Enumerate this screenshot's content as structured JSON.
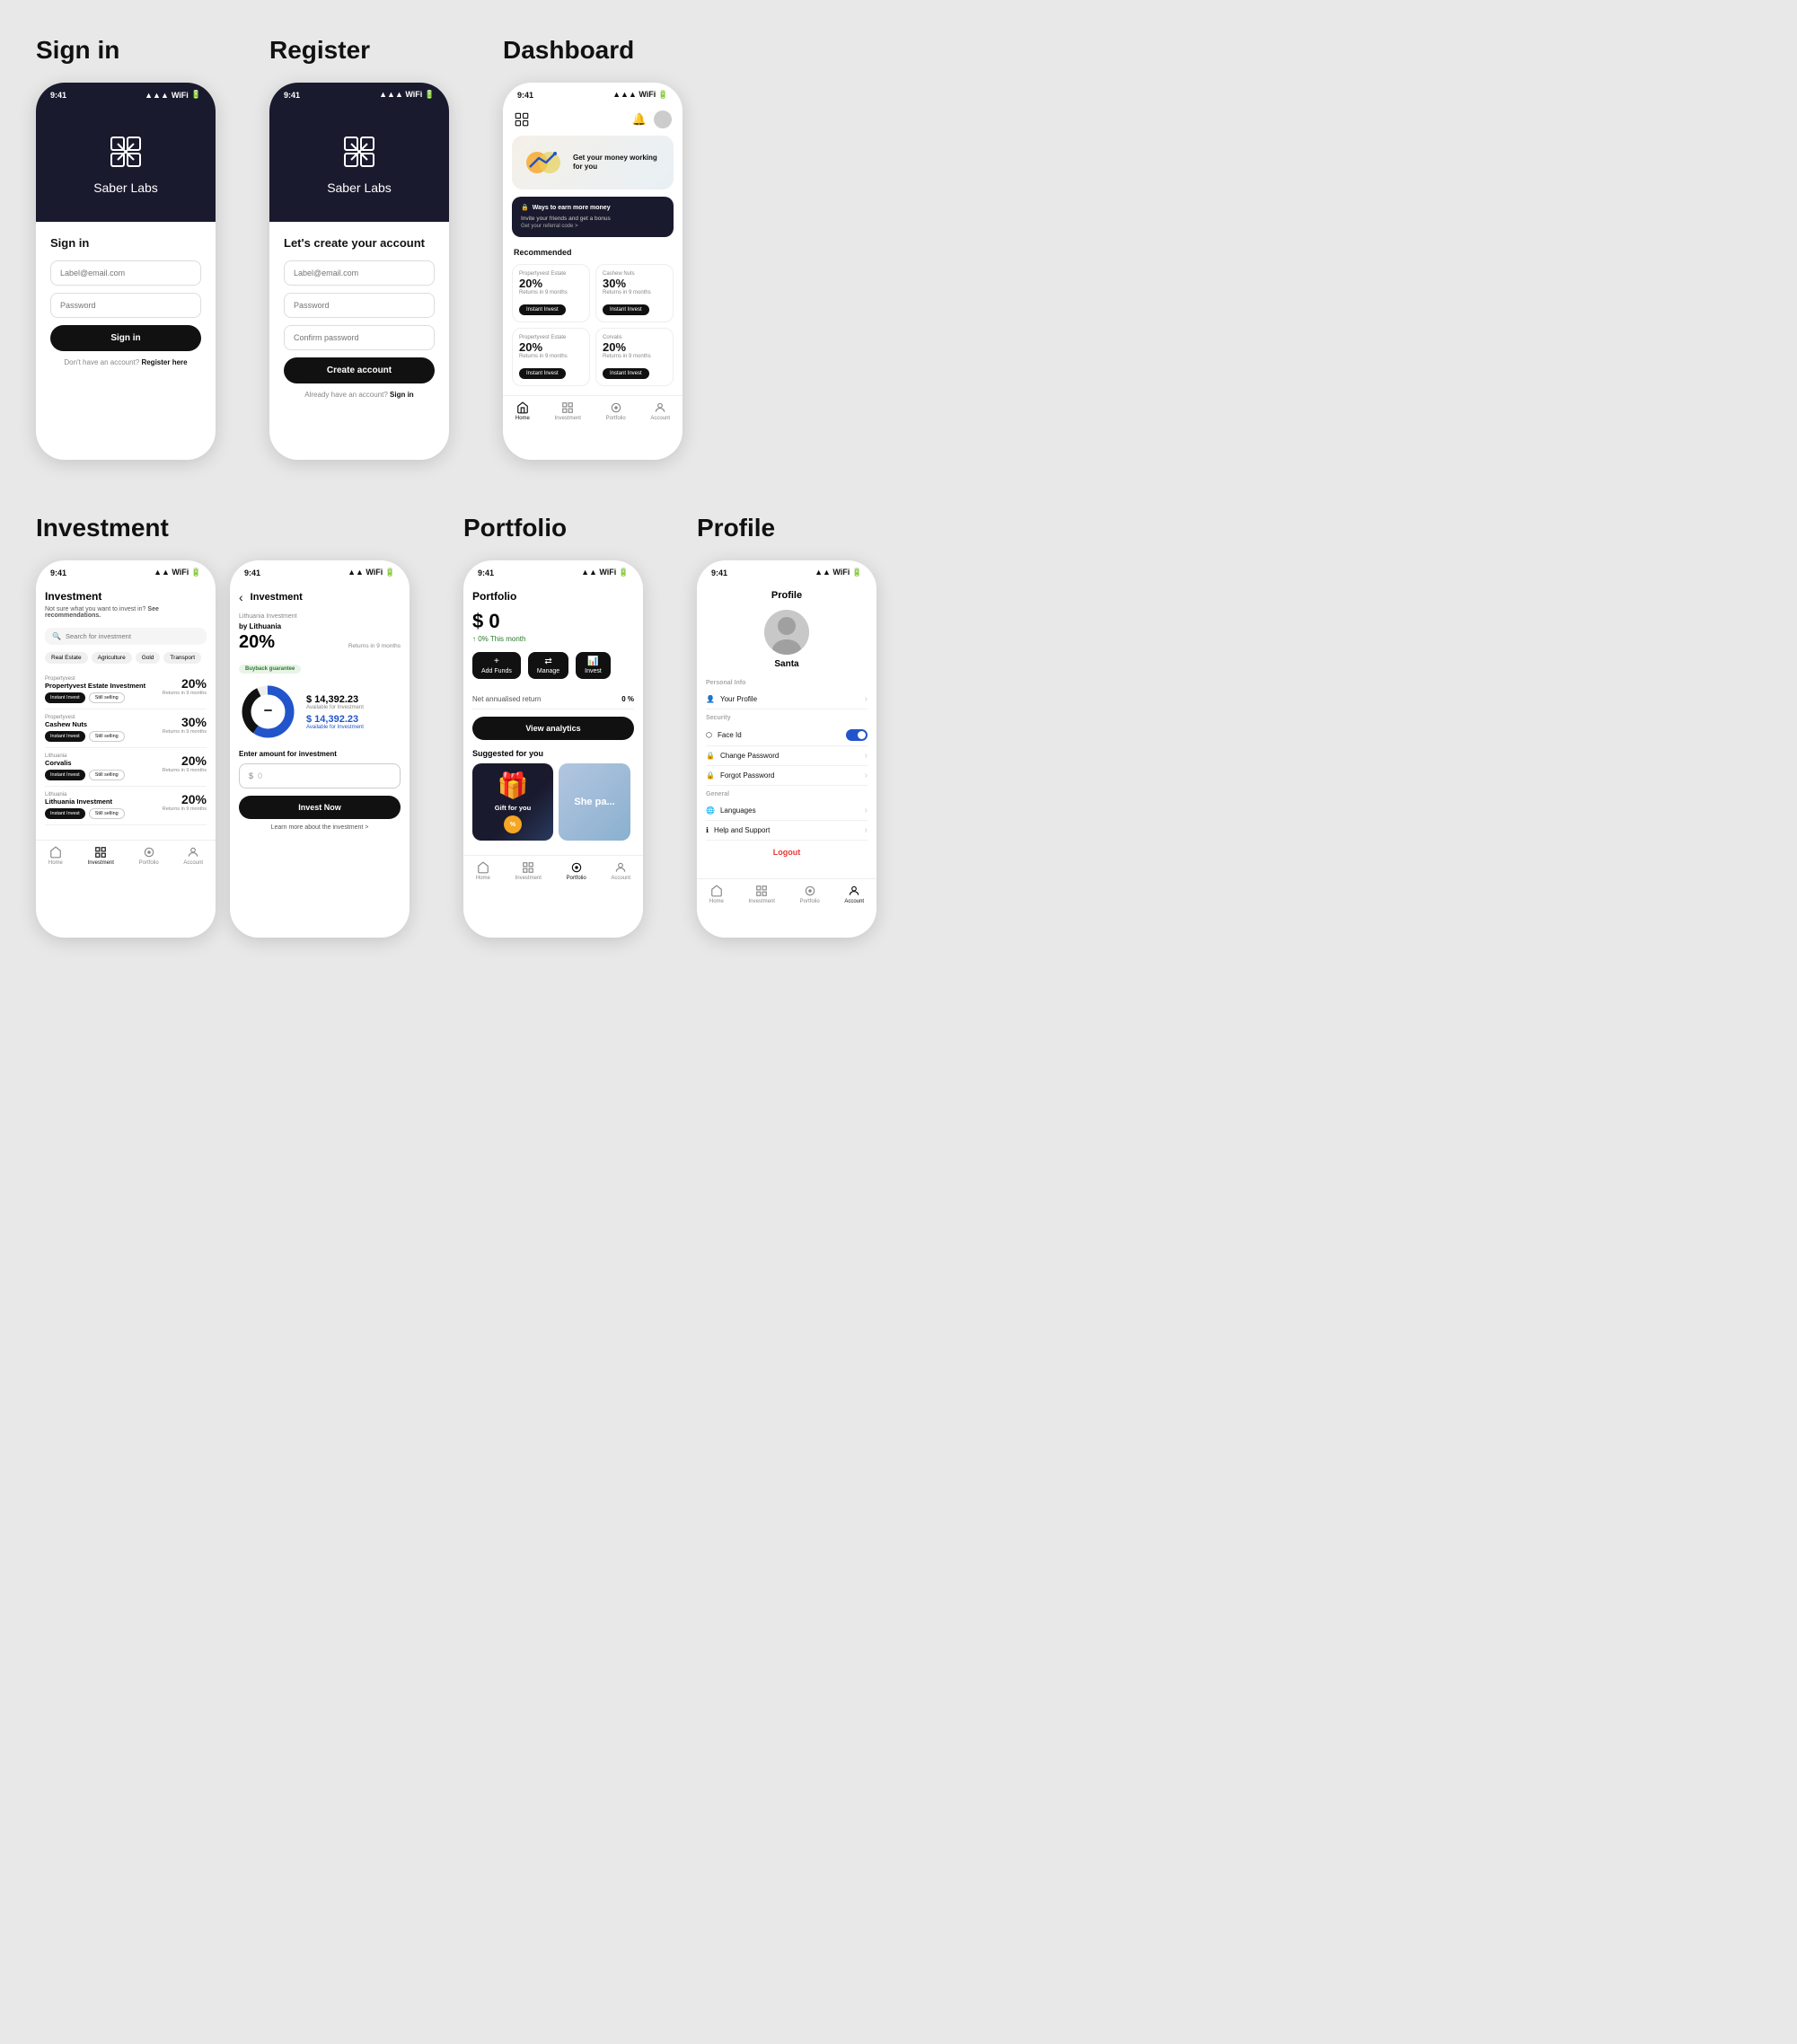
{
  "signin": {
    "title": "Sign in",
    "status_time": "9:41",
    "logo_brand": "Saber",
    "logo_sub": "Labs",
    "form_title": "Sign in",
    "email_placeholder": "Label@email.com",
    "password_placeholder": "Password",
    "button_label": "Sign in",
    "footer_text": "Don't have an account?",
    "footer_link": "Register here"
  },
  "register": {
    "title": "Register",
    "status_time": "9:41",
    "logo_brand": "Saber",
    "logo_sub": "Labs",
    "form_title": "Let's create your account",
    "email_placeholder": "Label@email.com",
    "password_placeholder": "Password",
    "confirm_placeholder": "Confirm password",
    "button_label": "Create account",
    "footer_text": "Already have an account?",
    "footer_link": "Sign in"
  },
  "dashboard": {
    "title": "Dashboard",
    "status_time": "9:41",
    "banner_heading": "Get your money working for you",
    "promo_title": "Ways to earn more money",
    "promo_line1": "Invite your friends and get a bonus",
    "promo_line2": "Get your referral code >",
    "recommended_label": "Recommended",
    "cards": [
      {
        "category": "Propertyvest Estate",
        "name": "Propertyvest Estate",
        "percent": "20%",
        "returns": "Returns in 9 months"
      },
      {
        "category": "Cashew Nuts",
        "name": "Cashew Nuts",
        "percent": "30%",
        "returns": "Returns in 9 months"
      },
      {
        "category": "Propertyvest Estate",
        "name": "Propertyvest Estate",
        "percent": "20%",
        "returns": "Returns in 9 months"
      },
      {
        "category": "Corvalis",
        "name": "Corvalis",
        "percent": "20%",
        "returns": "Returns in 9 months"
      }
    ],
    "btn_instant_invest": "Instant Invest",
    "nav": [
      "Home",
      "Investment",
      "Portfolio",
      "Account"
    ]
  },
  "investment_list": {
    "title": "Investment",
    "status_time": "9:41",
    "subtitle": "Not sure what you want to invest in? ",
    "subtitle_link": "See recommendations.",
    "search_placeholder": "Search for investment",
    "filters": [
      "Real Estate",
      "Agriculture",
      "Gold",
      "Transport"
    ],
    "items": [
      {
        "category": "Propertyvest",
        "name": "Propertyvest Estate Investment",
        "percent": "20%",
        "returns": "Returns in 9 months"
      },
      {
        "category": "Propertyvest",
        "name": "Cashew Nuts",
        "percent": "30%",
        "returns": "Returns in 9 months"
      },
      {
        "category": "Lithuania",
        "name": "Corvalis",
        "percent": "20%",
        "returns": "Returns in 9 months"
      },
      {
        "category": "Lithuania",
        "name": "Lithuania Investment",
        "percent": "20%",
        "returns": "Returns in 9 months"
      }
    ],
    "btn_invest": "Instant Invest",
    "btn_selling": "Still selling",
    "nav_active": "Investment",
    "nav": [
      "Home",
      "Investment",
      "Portfolio",
      "Account"
    ]
  },
  "investment_detail": {
    "status_time": "9:41",
    "back_label": "‹",
    "page_title": "Investment",
    "item_subtitle": "Lithuania Investment",
    "item_by": "by Lithuania",
    "percent": "20%",
    "returns_label": "Returns in 9 months",
    "badge": "Buyback guarantee",
    "chart_amount": "$ 14,392.23",
    "chart_label": "Available for Investment",
    "chart_amount2": "$ 14,392.23",
    "chart_label2": "Available for Investment",
    "enter_amount_label": "Enter amount for investment",
    "amount_symbol": "$",
    "amount_value": "0",
    "btn_invest_now": "Invest Now",
    "learn_more": "Learn more about the investment >"
  },
  "portfolio": {
    "title": "Portfolio",
    "status_time": "9:41",
    "amount": "$ 0",
    "change": "↑ 0% This month",
    "actions": [
      "Add Funds",
      "Manage",
      "Invest"
    ],
    "return_label": "Net annualised return",
    "return_value": "0 %",
    "btn_analytics": "View analytics",
    "suggested_label": "Suggested for you",
    "gift_text": "Gift for you",
    "nav_active": "Portfolio",
    "nav": [
      "Home",
      "Investment",
      "Portfolio",
      "Account"
    ]
  },
  "profile": {
    "title": "Profile",
    "status_time": "9:41",
    "name": "Santa",
    "personal_info_label": "Personal Info",
    "your_profile": "Your Profile",
    "security_label": "Security",
    "face_id": "Face Id",
    "change_password": "Change Password",
    "forgot_password": "Forgot Password",
    "general_label": "General",
    "languages": "Languages",
    "help_support": "Help and Support",
    "logout_label": "Logout",
    "nav_active": "Account",
    "nav": [
      "Home",
      "Investment",
      "Portfolio",
      "Account"
    ]
  },
  "icons": {
    "logo": "◈",
    "home": "⌂",
    "investment": "🛍",
    "portfolio": "◎",
    "account": "◉",
    "search": "🔍",
    "bell": "🔔",
    "back": "‹",
    "user": "👤",
    "lock": "🔒",
    "globe": "🌐",
    "help": "ℹ",
    "face": "⬡",
    "add": "+",
    "manage": "⇄",
    "invest_ico": "📊"
  }
}
